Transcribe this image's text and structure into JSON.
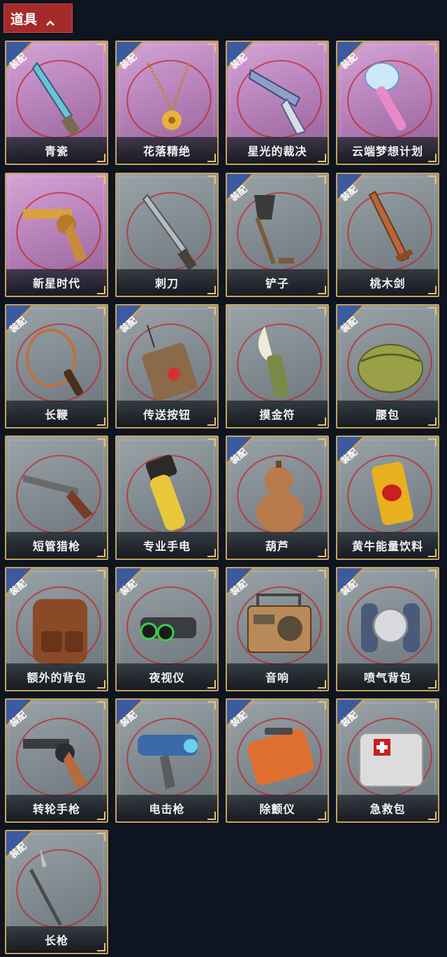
{
  "header": {
    "title": "道具"
  },
  "badge_text": "装配",
  "items": [
    {
      "name": "青瓷",
      "bg": "purple",
      "equipped": true,
      "icon": "dagger-icon"
    },
    {
      "name": "花落精绝",
      "bg": "purple",
      "equipped": true,
      "icon": "flower-necklace-icon"
    },
    {
      "name": "星光的裁决",
      "bg": "purple",
      "equipped": true,
      "icon": "ornate-pistol-icon"
    },
    {
      "name": "云端梦想计划",
      "bg": "purple",
      "equipped": true,
      "icon": "scepter-icon"
    },
    {
      "name": "新星时代",
      "bg": "purple",
      "equipped": false,
      "icon": "gold-revolver-icon"
    },
    {
      "name": "刺刀",
      "bg": "gray",
      "equipped": false,
      "icon": "bayonet-icon"
    },
    {
      "name": "铲子",
      "bg": "gray",
      "equipped": true,
      "icon": "shovel-icon"
    },
    {
      "name": "桃木剑",
      "bg": "gray",
      "equipped": true,
      "icon": "wooden-sword-icon"
    },
    {
      "name": "长鞭",
      "bg": "gray",
      "equipped": true,
      "icon": "whip-icon"
    },
    {
      "name": "传送按钮",
      "bg": "gray",
      "equipped": true,
      "icon": "teleport-button-icon"
    },
    {
      "name": "摸金符",
      "bg": "gray",
      "equipped": false,
      "icon": "talisman-icon"
    },
    {
      "name": "腰包",
      "bg": "gray",
      "equipped": true,
      "icon": "waist-bag-icon"
    },
    {
      "name": "短管猎枪",
      "bg": "gray",
      "equipped": false,
      "icon": "shotgun-icon"
    },
    {
      "name": "专业手电",
      "bg": "gray",
      "equipped": false,
      "icon": "flashlight-icon"
    },
    {
      "name": "葫芦",
      "bg": "gray",
      "equipped": true,
      "icon": "gourd-icon"
    },
    {
      "name": "黄牛能量饮料",
      "bg": "gray",
      "equipped": true,
      "icon": "energy-drink-icon"
    },
    {
      "name": "额外的背包",
      "bg": "gray",
      "equipped": true,
      "icon": "backpack-icon"
    },
    {
      "name": "夜视仪",
      "bg": "gray",
      "equipped": true,
      "icon": "night-vision-icon"
    },
    {
      "name": "音响",
      "bg": "gray",
      "equipped": true,
      "icon": "radio-icon"
    },
    {
      "name": "喷气背包",
      "bg": "gray",
      "equipped": true,
      "icon": "jetpack-icon"
    },
    {
      "name": "转轮手枪",
      "bg": "gray",
      "equipped": true,
      "icon": "revolver-icon"
    },
    {
      "name": "电击枪",
      "bg": "gray",
      "equipped": true,
      "icon": "taser-gun-icon"
    },
    {
      "name": "除颤仪",
      "bg": "gray",
      "equipped": true,
      "icon": "defibrillator-icon"
    },
    {
      "name": "急救包",
      "bg": "gray",
      "equipped": true,
      "icon": "first-aid-kit-icon"
    },
    {
      "name": "长枪",
      "bg": "gray",
      "equipped": true,
      "icon": "spear-icon"
    }
  ]
}
